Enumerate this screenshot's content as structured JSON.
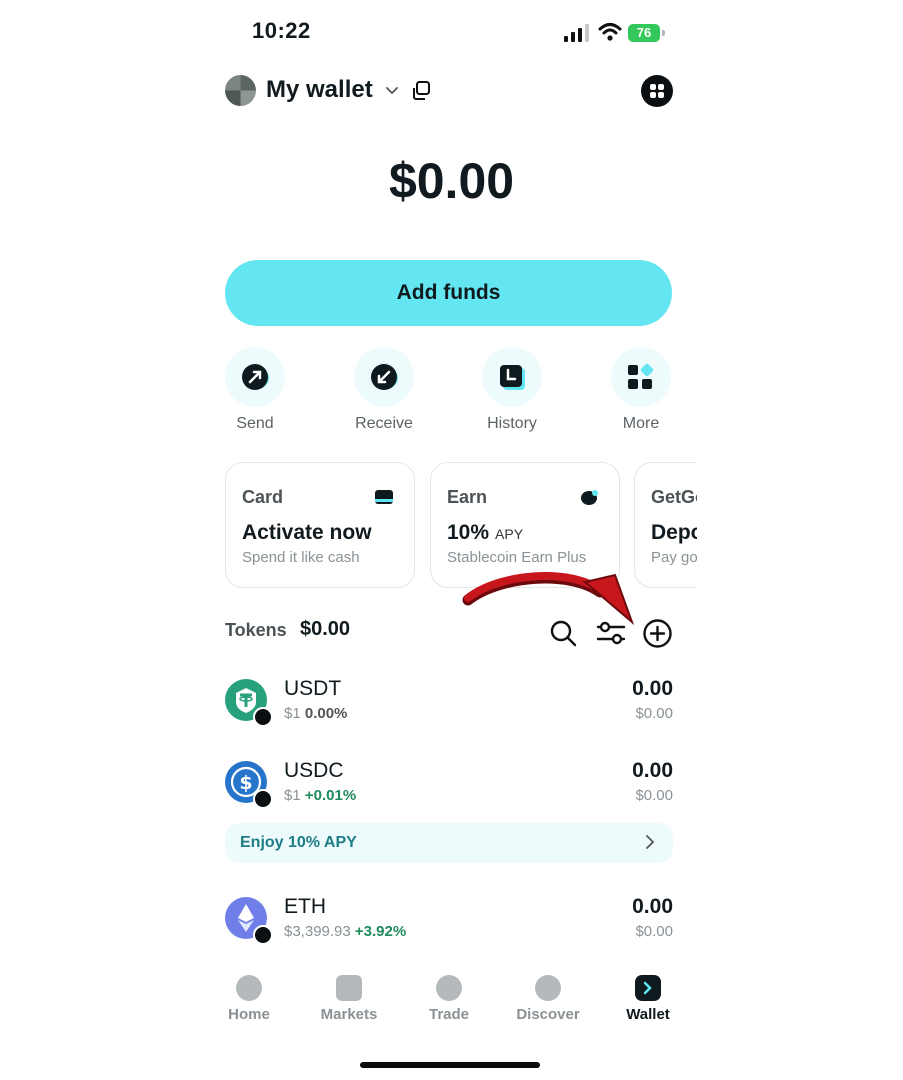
{
  "status_bar": {
    "time": "10:22",
    "battery": "76"
  },
  "header": {
    "wallet_name": "My wallet"
  },
  "balance": {
    "total": "$0.00"
  },
  "add_funds_label": "Add funds",
  "actions": [
    {
      "label": "Send",
      "icon": "arrow-up-right-icon"
    },
    {
      "label": "Receive",
      "icon": "arrow-down-left-icon"
    },
    {
      "label": "History",
      "icon": "history-icon"
    },
    {
      "label": "More",
      "icon": "grid-icon"
    }
  ],
  "cards": [
    {
      "title": "Card",
      "headline": "Activate now",
      "sub": "Spend it like cash",
      "icon": "card-icon"
    },
    {
      "title": "Earn",
      "headline": "10%",
      "headline_suffix": "APY",
      "sub": "Stablecoin Earn Plus",
      "icon": "piggy-bank-icon"
    },
    {
      "title": "GetGo",
      "headline": "Deposit",
      "sub": "Pay go",
      "icon": ""
    }
  ],
  "tokens": {
    "label": "Tokens",
    "total": "$0.00",
    "items": [
      {
        "symbol": "USDT",
        "price": "$1",
        "change": "0.00%",
        "amount": "0.00",
        "value": "$0.00",
        "color": "#26a17b"
      },
      {
        "symbol": "USDC",
        "price": "$1",
        "change": "+0.01%",
        "amount": "0.00",
        "value": "$0.00",
        "color": "#2775ca"
      },
      {
        "symbol": "ETH",
        "price": "$3,399.93",
        "change": "+3.92%",
        "amount": "0.00",
        "value": "$0.00",
        "color": "#6f7ee8"
      }
    ]
  },
  "promo": {
    "text": "Enjoy 10% APY"
  },
  "bottom_nav": [
    {
      "label": "Home",
      "active": false
    },
    {
      "label": "Markets",
      "active": false
    },
    {
      "label": "Trade",
      "active": false
    },
    {
      "label": "Discover",
      "active": false
    },
    {
      "label": "Wallet",
      "active": true
    }
  ],
  "colors": {
    "accent": "#63e6f1",
    "positive": "#1f8a5b",
    "annotation_arrow": "#c8161d"
  }
}
